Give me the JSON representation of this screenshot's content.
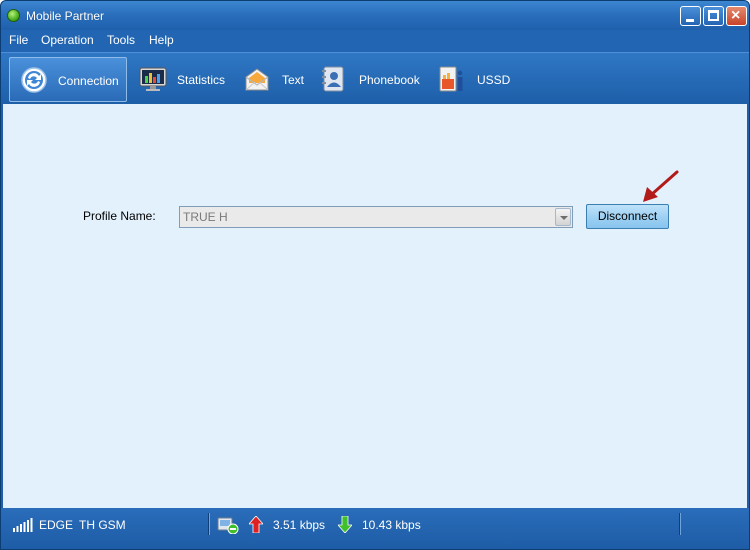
{
  "window": {
    "title": "Mobile Partner"
  },
  "menu": [
    "File",
    "Operation",
    "Tools",
    "Help"
  ],
  "toolbar": {
    "items": [
      {
        "label": "Connection",
        "icon": "connection-icon",
        "active": true
      },
      {
        "label": "Statistics",
        "icon": "statistics-icon",
        "active": false
      },
      {
        "label": "Text",
        "icon": "text-message-icon",
        "active": false
      },
      {
        "label": "Phonebook",
        "icon": "phonebook-icon",
        "active": false
      },
      {
        "label": "USSD",
        "icon": "ussd-icon",
        "active": false
      }
    ]
  },
  "connection": {
    "profile_label": "Profile Name:",
    "profile_value": "TRUE H",
    "disconnect_label": "Disconnect"
  },
  "status": {
    "network": "EDGE",
    "operator": "TH GSM",
    "upload": "3.51 kbps",
    "download": "10.43 kbps"
  },
  "colors": {
    "frame": "#1f5fa6",
    "content_bg": "#e2f1fc",
    "button_bg": "#9fd1f3",
    "annotation_arrow": "#b31b1b",
    "upload_arrow": "#e02020",
    "download_arrow": "#3fbf2a"
  }
}
